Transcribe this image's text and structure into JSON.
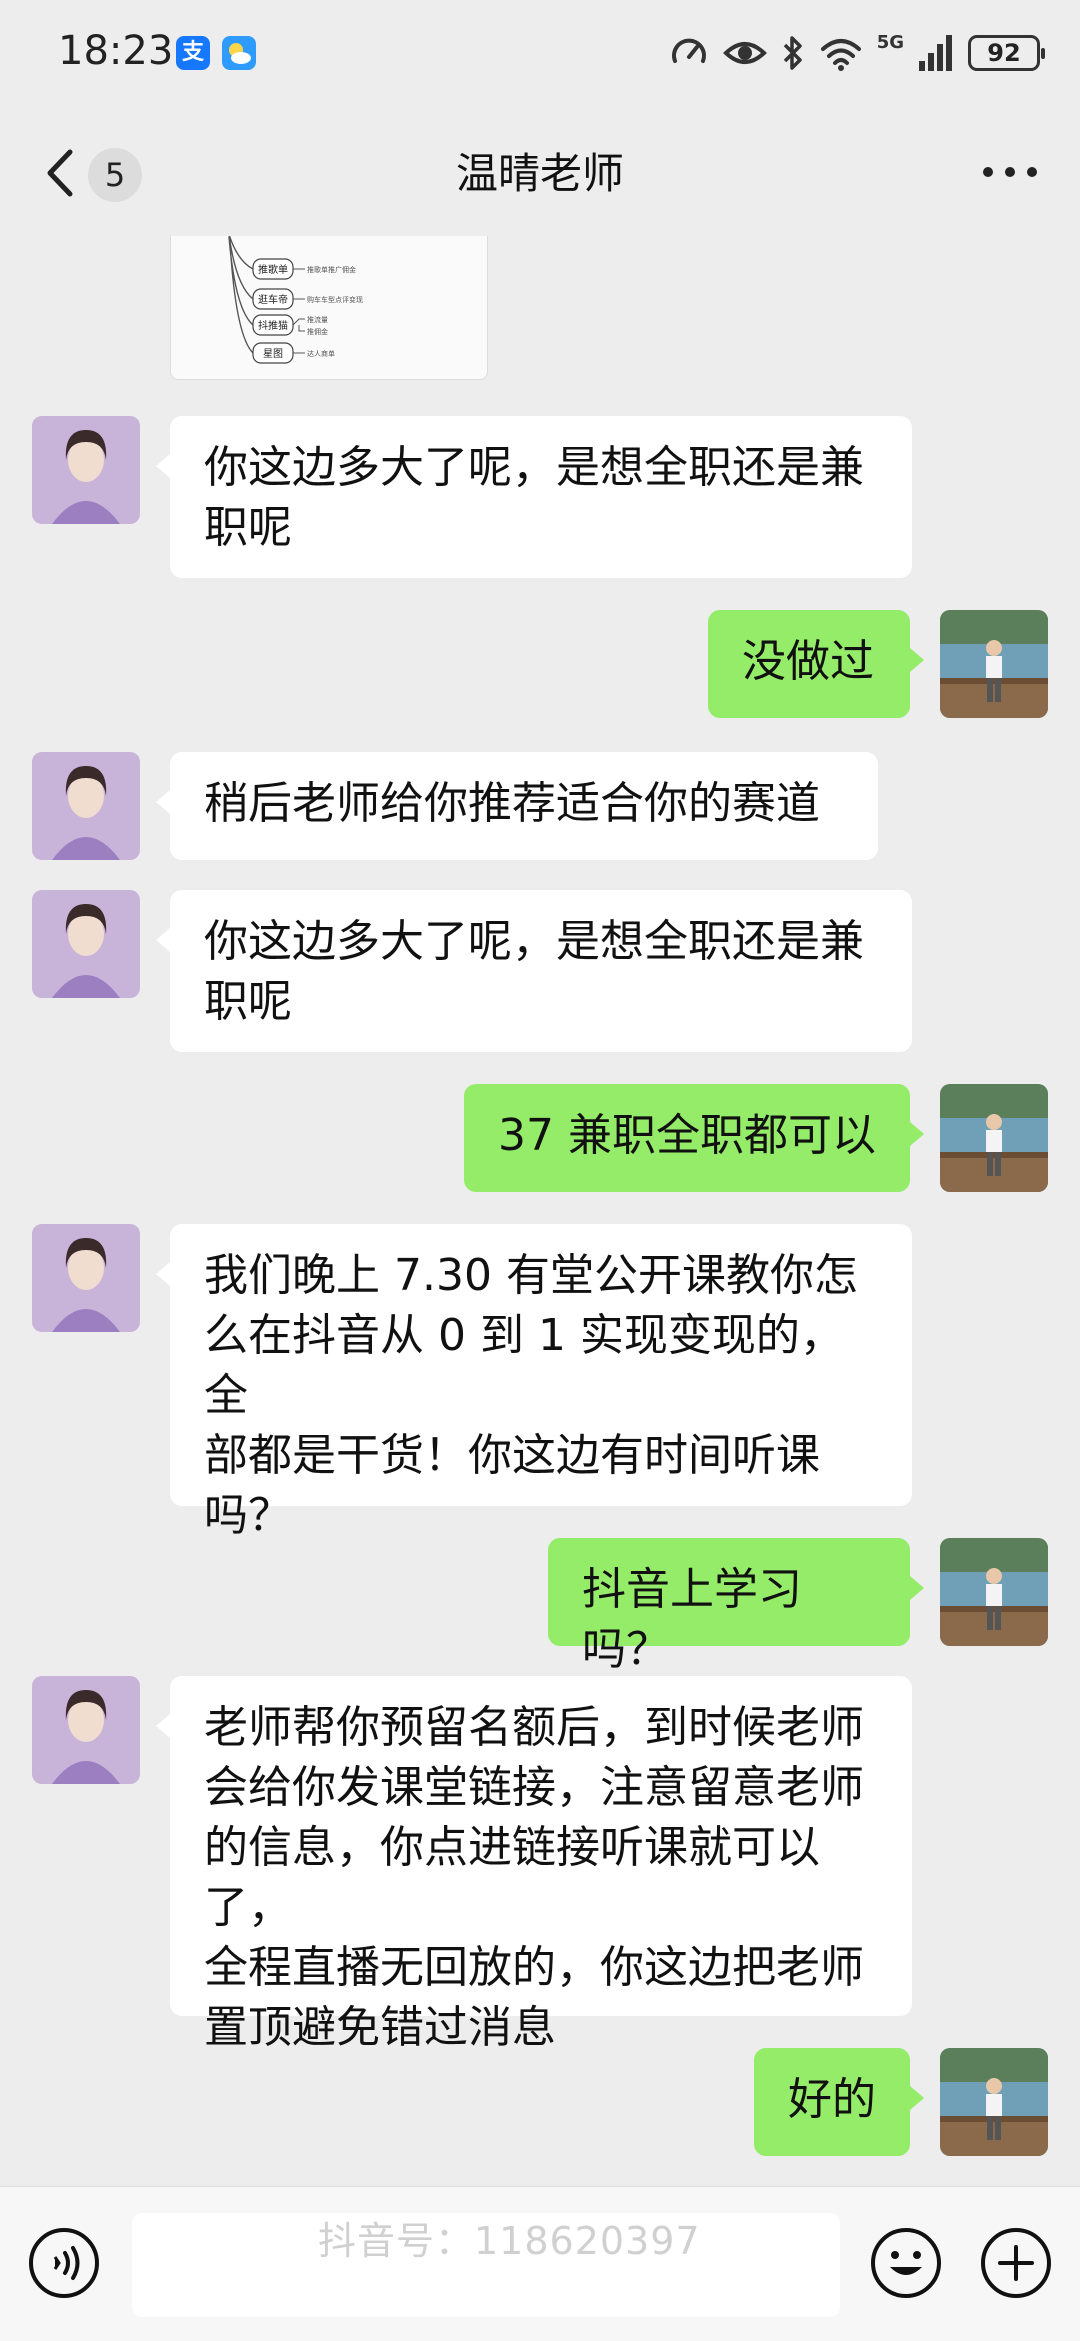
{
  "status_bar": {
    "time": "18:23",
    "app_icons": [
      "alipay-icon",
      "weather-icon"
    ],
    "alipay_glyph": "支",
    "network": "5G",
    "battery": "92"
  },
  "header": {
    "unread_count": "5",
    "title": "温晴老师"
  },
  "image_message": {
    "mindmap_nodes": [
      "推歌单",
      "逛车帝",
      "抖推猫",
      "星图"
    ],
    "mindmap_notes": [
      "推歌单推广佣金",
      "购车车型点评变现",
      "推流量",
      "推佣金",
      "达人商单"
    ]
  },
  "messages": [
    {
      "from": "in",
      "text": "你这边多大了呢，是想全职还是兼\n职呢"
    },
    {
      "from": "out",
      "text": "没做过"
    },
    {
      "from": "in",
      "text": "稍后老师给你推荐适合你的赛道"
    },
    {
      "from": "in",
      "text": "你这边多大了呢，是想全职还是兼\n职呢"
    },
    {
      "from": "out",
      "text": "37 兼职全职都可以"
    },
    {
      "from": "in",
      "text": "我们晚上 7.30 有堂公开课教你怎\n么在抖音从 0 到 1 实现变现的，全\n部都是干货！你这边有时间听课\n吗？"
    },
    {
      "from": "out",
      "text": "抖音上学习吗？"
    },
    {
      "from": "in",
      "text": "老师帮你预留名额后，到时候老师\n会给你发课堂链接，注意留意老师\n的信息，你点进链接听课就可以了，\n全程直播无回放的，你这边把老师\n置顶避免错过消息"
    },
    {
      "from": "out",
      "text": "好的"
    }
  ],
  "input_bar": {
    "watermark": "抖音号：118620397",
    "icons": [
      "voice-icon",
      "emoji-icon",
      "plus-icon"
    ]
  },
  "colors": {
    "background": "#ededed",
    "bubble_out": "#95ec69",
    "bubble_in": "#ffffff"
  }
}
